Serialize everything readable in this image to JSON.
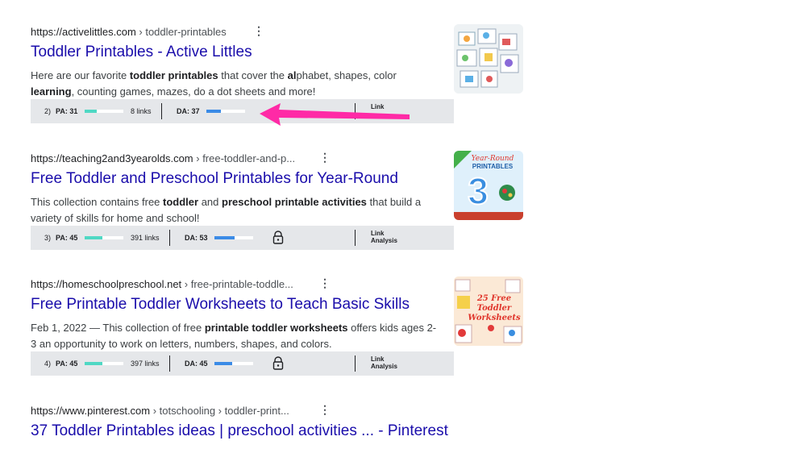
{
  "results": [
    {
      "domain": "https://activelittles.com",
      "crumb": " › toddler-printables",
      "title": "Toddler Printables - Active Littles",
      "snippet_html": "Here are our favorite <b>toddler printables</b> that cover the <b>al</b>phabet, shapes, color <b>learning</b>, counting games, mazes, do a dot sheets and more!",
      "rank": "2)",
      "pa_label": "PA: 31",
      "pa_value": 31,
      "links": "8 links",
      "da_label": "DA: 37",
      "da_value": 37,
      "link_label": "Link",
      "analysis_label": ""
    },
    {
      "domain": "https://teaching2and3yearolds.com",
      "crumb": " › free-toddler-and-p...",
      "title": "Free Toddler and Preschool Printables for Year-Round",
      "snippet_html": "This collection contains free <b>toddler</b> and <b>preschool printable activities</b> that build a variety of skills for home and school!",
      "rank": "3)",
      "pa_label": "PA: 45",
      "pa_value": 45,
      "links": "391 links",
      "da_label": "DA: 53",
      "da_value": 53,
      "link_label": "Link",
      "analysis_label": "Analysis"
    },
    {
      "domain": "https://homeschoolpreschool.net",
      "crumb": " › free-printable-toddle...",
      "title": "Free Printable Toddler Worksheets to Teach Basic Skills",
      "snippet_html": "Feb 1, 2022 — This collection of free <b>printable toddler worksheets</b> offers kids ages 2-3 an opportunity to work on letters, numbers, shapes, and colors.",
      "rank": "4)",
      "pa_label": "PA: 45",
      "pa_value": 45,
      "links": "397 links",
      "da_label": "DA: 45",
      "da_value": 45,
      "link_label": "Link",
      "analysis_label": "Analysis"
    },
    {
      "domain": "https://www.pinterest.com",
      "crumb": " › totschooling › toddler-print...",
      "title": "37 Toddler Printables ideas | preschool activities ... - Pinterest"
    }
  ],
  "thumb2": {
    "line1": "Year-Round",
    "line2": "PRINTABLES",
    "numeral": "3"
  },
  "thumb3": {
    "line1": "25 Free",
    "line2": "Toddler",
    "line3": "Worksheets"
  },
  "colors": {
    "title": "#1a0dab",
    "pa": "#4fd8c4",
    "da": "#3b8be6",
    "arrow": "#ff2aa6"
  },
  "icons": {
    "more": "more-vert-icon",
    "lock": "lock-icon",
    "arrow": "annotation-arrow-icon"
  },
  "more_glyph": "⋮"
}
